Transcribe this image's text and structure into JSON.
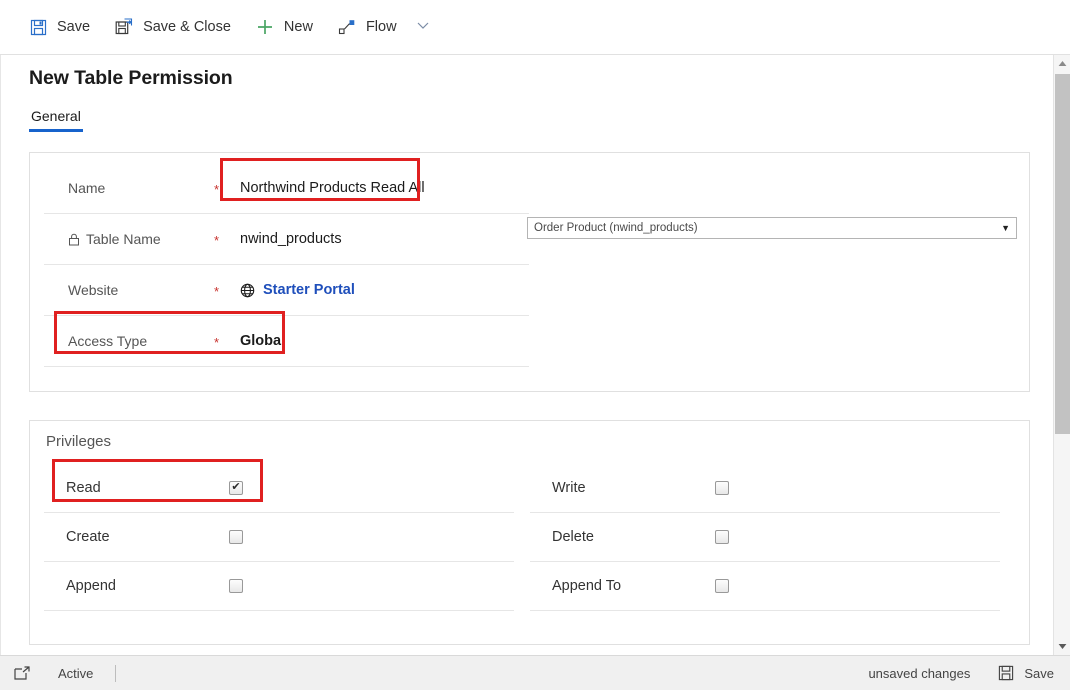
{
  "command_bar": {
    "buttons": [
      {
        "label": "Save",
        "icon": "save-floppy-icon"
      },
      {
        "label": "Save & Close",
        "icon": "save-and-close-floppy-icon"
      },
      {
        "label": "New",
        "icon": "plus-icon"
      },
      {
        "label": "Flow",
        "icon": "flow-icon"
      }
    ],
    "overflow_caret": "chevron-down-icon"
  },
  "page": {
    "title": "New Table Permission",
    "tabs": [
      {
        "label": "General",
        "active": true
      }
    ]
  },
  "general": {
    "fields": [
      {
        "label": "Name",
        "required": "*",
        "value": "Northwind Products Read All",
        "locked": false,
        "highlighted": true,
        "kind": "text"
      },
      {
        "label": "Table Name",
        "required": "*",
        "value": "nwind_products",
        "locked": true,
        "highlighted": false,
        "kind": "text"
      },
      {
        "label": "Website",
        "required": "*",
        "value": "Starter Portal",
        "locked": false,
        "highlighted": false,
        "kind": "link"
      },
      {
        "label": "Access Type",
        "required": "*",
        "value": "Global",
        "locked": false,
        "highlighted": true,
        "kind": "bold"
      }
    ],
    "table_lookup": {
      "selected": "Order Product (nwind_products)",
      "caret": "▼"
    }
  },
  "privileges": {
    "heading": "Privileges",
    "left_column": [
      {
        "label": "Read",
        "checked": true,
        "highlighted": true
      },
      {
        "label": "Create",
        "checked": false,
        "highlighted": false
      },
      {
        "label": "Append",
        "checked": false,
        "highlighted": false
      }
    ],
    "right_column": [
      {
        "label": "Write",
        "checked": false,
        "highlighted": false
      },
      {
        "label": "Delete",
        "checked": false,
        "highlighted": false
      },
      {
        "label": "Append To",
        "checked": false,
        "highlighted": false
      }
    ],
    "check_glyph": "✔"
  },
  "status_bar": {
    "state_icon": "open-record-icon",
    "state": "Active",
    "unsaved": "unsaved changes",
    "save_label": "Save",
    "save_icon": "save-floppy-icon"
  },
  "scrollbar": {
    "up_arrow": "▲",
    "down_arrow": "▼"
  },
  "colors": {
    "accent": "#1763cc",
    "link": "#1f4fbb",
    "required": "#c8322e",
    "highlight": "#e02020"
  }
}
